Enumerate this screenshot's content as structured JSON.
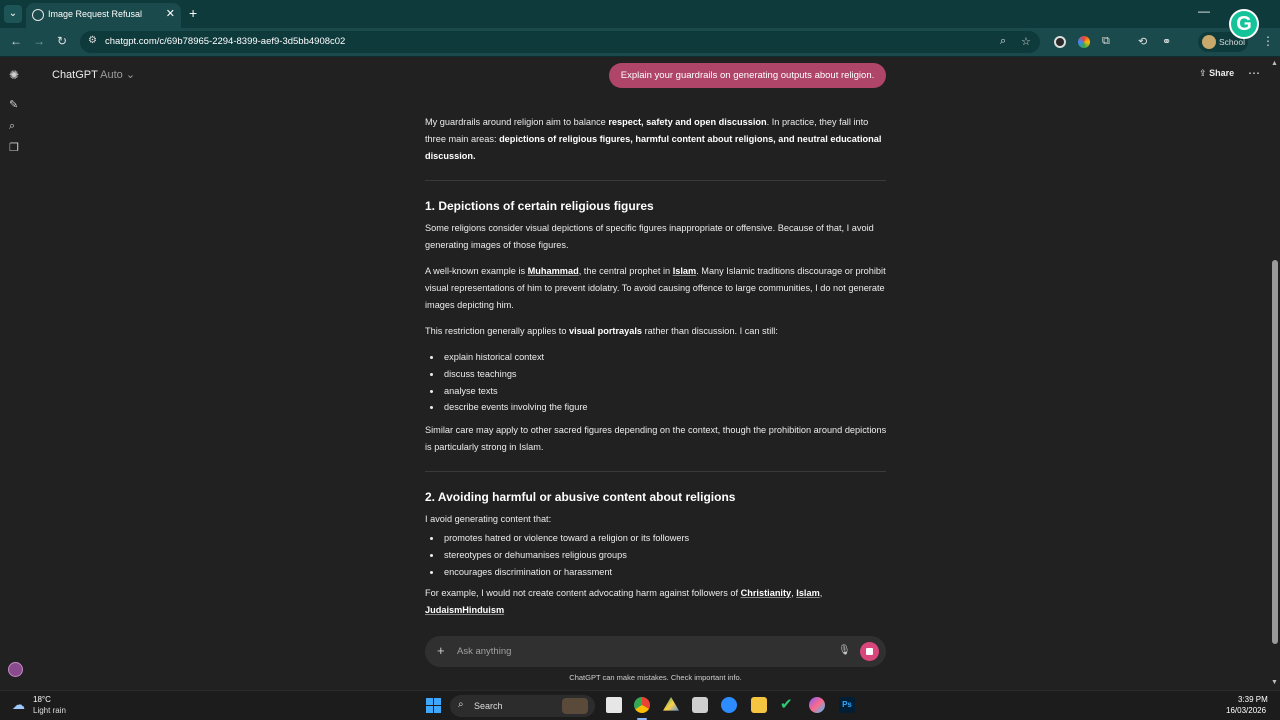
{
  "browser": {
    "tab_title": "Image Request Refusal",
    "url": "chatgpt.com/c/69b78965-2294-8399-aef9-3d5bb4908c02",
    "profile_label": "School",
    "accent_color": "#1a4a4c"
  },
  "header": {
    "model_name": "ChatGPT",
    "model_mode": "Auto",
    "share_label": "Share"
  },
  "user_message": "Explain your guardrails on generating outputs about religion.",
  "response": {
    "intro_a": "My guardrails around religion aim to balance ",
    "intro_b": "respect, safety and open discussion",
    "intro_c": ". In practice, they fall into three main areas: ",
    "intro_d": "depictions of religious figures, harmful content about religions, and neutral educational discussion.",
    "s1_title": "1. Depictions of certain religious figures",
    "s1_p1": "Some religions consider visual depictions of specific figures inappropriate or offensive. Because of that, I avoid generating images of those figures.",
    "s1_p2_a": "A well-known example is ",
    "s1_p2_b": "Muhammad",
    "s1_p2_c": ", the central prophet in ",
    "s1_p2_d": "Islam",
    "s1_p2_e": ". Many Islamic traditions discourage or prohibit visual representations of him to prevent idolatry. To avoid causing offence to large communities, I do not generate images depicting him.",
    "s1_p3_a": "This restriction generally applies to ",
    "s1_p3_b": "visual portrayals",
    "s1_p3_c": " rather than discussion. I can still:",
    "s1_list": [
      "explain historical context",
      "discuss teachings",
      "analyse texts",
      "describe events involving the figure"
    ],
    "s1_p4": "Similar care may apply to other sacred figures depending on the context, though the prohibition around depictions is particularly strong in Islam.",
    "s2_title": "2. Avoiding harmful or abusive content about religions",
    "s2_p1": "I avoid generating content that:",
    "s2_list": [
      "promotes hatred or violence toward a religion or its followers",
      "stereotypes or dehumanises religious groups",
      "encourages discrimination or harassment"
    ],
    "s2_p2_a": "For example, I would not create content advocating harm against followers of ",
    "s2_p2_b": "Christianity",
    "s2_p2_c": ", ",
    "s2_p2_d": "Islam",
    "s2_p2_e": ",",
    "s2_p2_f": "JudaismHinduism"
  },
  "composer": {
    "placeholder": "Ask anything",
    "disclaimer": "ChatGPT can make mistakes. Check important info."
  },
  "taskbar": {
    "temperature": "18°C",
    "weather": "Light rain",
    "search_label": "Search",
    "time": "3:39 PM",
    "date": "16/03/2026"
  }
}
